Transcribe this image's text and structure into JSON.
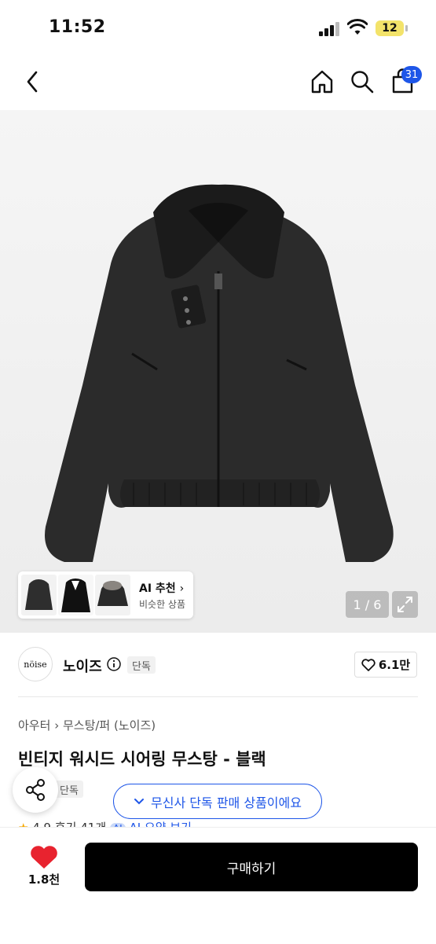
{
  "status": {
    "time": "11:52",
    "battery": "12"
  },
  "header": {
    "cart_count": "31"
  },
  "gallery": {
    "ai_title": "AI 추천",
    "ai_subtitle": "비슷한 상품",
    "counter": "1 / 6"
  },
  "brand": {
    "logo_text": "nöise",
    "name": "노이즈",
    "badge": "단독",
    "likes": "6.1만"
  },
  "product": {
    "breadcrumb_1": "아우터",
    "breadcrumb_2": "무스탕/퍼 (노이즈)",
    "title": "빈티지 워시드 시어링 무스탕 - 블랙",
    "tag": "단독",
    "musinsa_notice": "무신사 단독 판매 상품이에요",
    "rating": "4.9",
    "reviews": "후기 41개",
    "ai_summary": "AI 요약 보기"
  },
  "bottom": {
    "heart_count": "1.8천",
    "buy_label": "구매하기"
  },
  "colors": {
    "accent": "#1e56e8",
    "heart": "#e8232f",
    "star": "#f7a800"
  }
}
